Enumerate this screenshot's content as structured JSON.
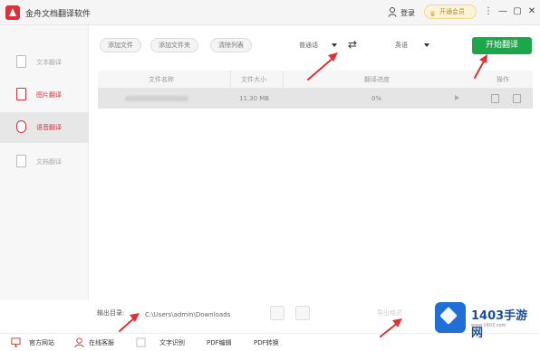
{
  "app": {
    "title": "金舟文档翻译软件",
    "login_label": "登录",
    "vip_label": "开通会员"
  },
  "window_controls": {
    "menu": "⋮",
    "minimize": "—",
    "maximize": "▢",
    "close": "✕"
  },
  "sidebar": {
    "items": [
      {
        "label": "文本翻译",
        "icon": "doc-icon",
        "active": false
      },
      {
        "label": "图片翻译",
        "icon": "image-icon",
        "active": false
      },
      {
        "label": "语音翻译",
        "icon": "voice-icon",
        "active": true
      },
      {
        "label": "文档翻译",
        "icon": "file-icon",
        "active": false
      }
    ]
  },
  "toolbar": {
    "add_file": "添加文件",
    "add_folder": "添加文件夹",
    "clear_list": "清除列表",
    "source_lang": "普通话",
    "target_lang": "英语",
    "start": "开始翻译"
  },
  "table": {
    "headers": [
      "文件名称",
      "文件大小",
      "翻译进度",
      "操作"
    ],
    "rows": [
      {
        "name": "",
        "size": "11.30 MB",
        "progress": "0%"
      }
    ]
  },
  "output": {
    "label": "输出目录:",
    "path": "C:\\Users\\admin\\Downloads",
    "export": "导出格式"
  },
  "bottom": {
    "items": [
      {
        "label": "官方网站",
        "icon": "monitor-icon"
      },
      {
        "label": "在线客服",
        "icon": "support-icon"
      },
      {
        "label": "文字识别",
        "icon": "ocr-icon"
      },
      {
        "label": "PDF编辑",
        "icon": "pdf-edit-icon"
      },
      {
        "label": "PDF转换",
        "icon": "pdf-convert-icon"
      }
    ]
  },
  "watermark": {
    "title": "1403手游网",
    "sub": "www.1403.com"
  },
  "colors": {
    "brand_red": "#d8323c",
    "start_green": "#1ea64a",
    "arrow_red": "#e03030"
  }
}
